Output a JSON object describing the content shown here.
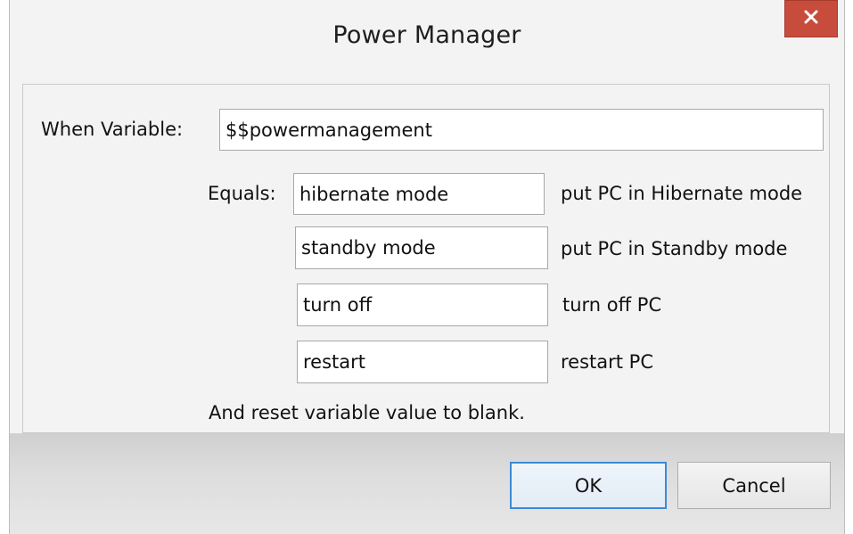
{
  "window": {
    "title": "Power Manager"
  },
  "form": {
    "variable_label": "When Variable:",
    "variable_value": "$$powermanagement",
    "equals_label": "Equals:",
    "rows": [
      {
        "value": "hibernate mode",
        "description": "put PC in Hibernate mode"
      },
      {
        "value": "standby mode",
        "description": "put PC in Standby mode"
      },
      {
        "value": "turn off",
        "description": "turn off PC"
      },
      {
        "value": "restart",
        "description": "restart PC"
      }
    ],
    "reset_note": "And reset variable value to blank."
  },
  "buttons": {
    "ok": "OK",
    "cancel": "Cancel"
  },
  "icons": {
    "close": "close-icon"
  },
  "colors": {
    "close_button": "#c74c3c",
    "ok_border": "#3c8ad6"
  }
}
